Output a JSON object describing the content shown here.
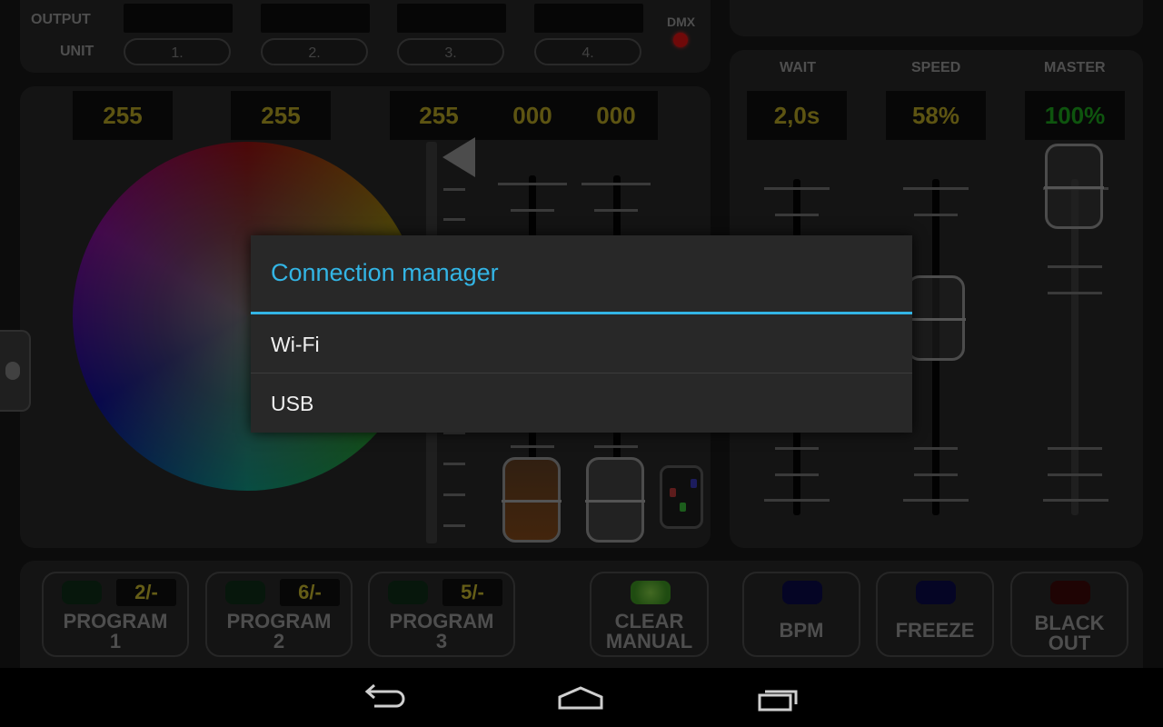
{
  "header": {
    "output_label": "OUTPUT",
    "unit_label": "UNIT",
    "units": [
      "1.",
      "2.",
      "3.",
      "4."
    ],
    "dmx_label": "DMX"
  },
  "color_values": {
    "v1": "255",
    "v2": "255",
    "v3": "255",
    "v4": "000",
    "v5": "000"
  },
  "right_panel": {
    "wait_label": "WAIT",
    "speed_label": "SPEED",
    "master_label": "MASTER",
    "wait_value": "2,0s",
    "speed_value": "58%",
    "master_value": "100%"
  },
  "bottom": {
    "programs": [
      {
        "count": "2/-",
        "line1": "PROGRAM",
        "line2": "1"
      },
      {
        "count": "6/-",
        "line1": "PROGRAM",
        "line2": "2"
      },
      {
        "count": "5/-",
        "line1": "PROGRAM",
        "line2": "3"
      }
    ],
    "clear_line1": "CLEAR",
    "clear_line2": "MANUAL",
    "bpm": "BPM",
    "freeze": "FREEZE",
    "black_line1": "BLACK",
    "black_line2": "OUT"
  },
  "dialog": {
    "title": "Connection manager",
    "items": [
      "Wi-Fi",
      "USB"
    ]
  },
  "colors": {
    "accent": "#33b5e5",
    "value_text": "#a99a22",
    "master_value_text": "#1a9a1a",
    "dmx_led": "#cc1111"
  },
  "icons": {
    "back": "back-icon",
    "home": "home-icon",
    "recents": "recent-apps-icon",
    "drawer": "drawer-handle-icon"
  }
}
